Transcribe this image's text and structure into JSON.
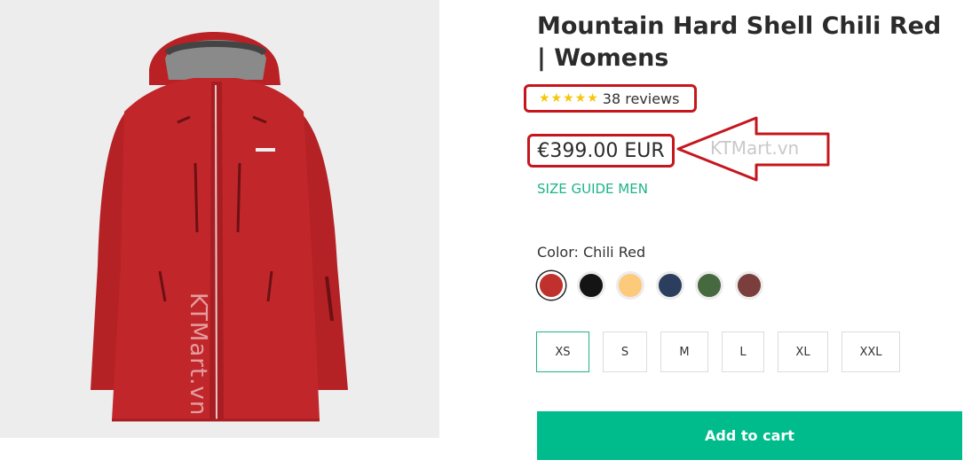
{
  "product": {
    "title": "Mountain Hard Shell Chili Red | Womens",
    "image_alt": "red hard shell jacket",
    "rating": {
      "stars": "★★★★★",
      "reviews": "38 reviews",
      "value": 5
    },
    "price": "€399.00 EUR",
    "size_guide": "SIZE GUIDE MEN",
    "color_label": "Color: Chili Red",
    "colors": [
      {
        "name": "chili-red",
        "hex": "#c0302c",
        "selected": true
      },
      {
        "name": "black",
        "hex": "#141414",
        "selected": false
      },
      {
        "name": "yellow",
        "hex": "#fdc97b",
        "selected": false
      },
      {
        "name": "navy",
        "hex": "#2c3e5e",
        "selected": false
      },
      {
        "name": "green",
        "hex": "#46693f",
        "selected": false
      },
      {
        "name": "brown",
        "hex": "#7a3e3c",
        "selected": false
      }
    ],
    "sizes": [
      "XS",
      "S",
      "M",
      "L",
      "XL",
      "XXL"
    ],
    "selected_size": "XS",
    "add_to_cart": "Add to cart"
  },
  "watermarks": {
    "vertical": "KTMart.vn",
    "arrow": "KTMart.vn"
  },
  "annotations": {
    "highlight_color": "#c5161d"
  },
  "theme": {
    "accent": "#00bc8c",
    "jacket_color": "#c1262a"
  }
}
